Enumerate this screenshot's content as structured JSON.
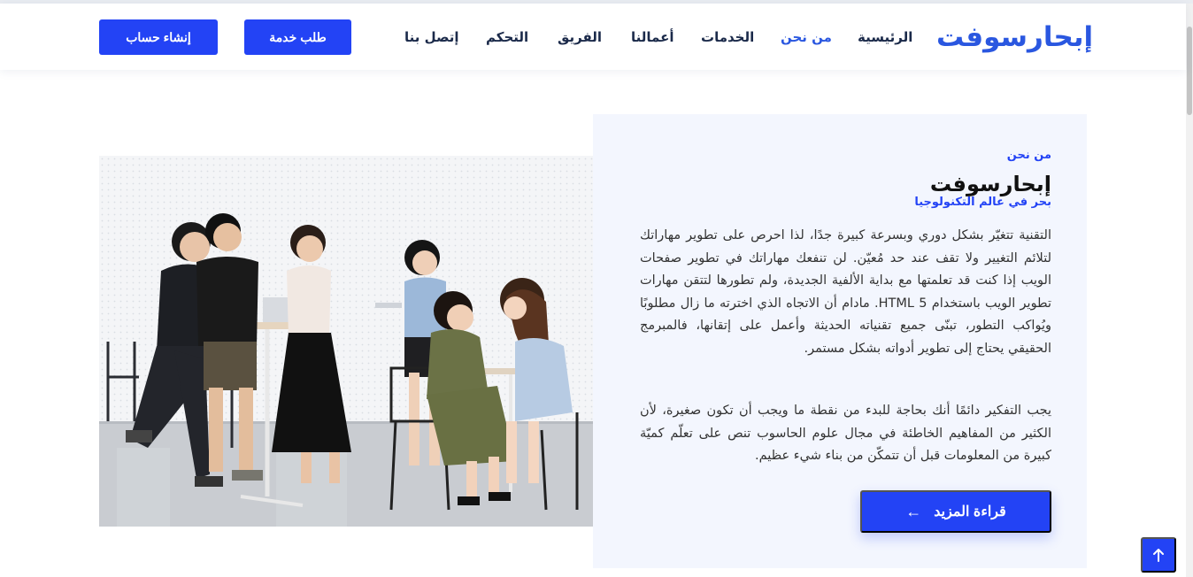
{
  "header": {
    "logo": "إبحارسوفت",
    "nav": [
      {
        "label": "الرئيسية"
      },
      {
        "label": "من نحن"
      },
      {
        "label": "الخدمات"
      },
      {
        "label": "أعمالنا"
      },
      {
        "label": "الفريق"
      },
      {
        "label": "التحكم"
      },
      {
        "label": "إتصل بنا"
      }
    ],
    "request_service": "طلب خدمة",
    "create_account": "إنشاء حساب"
  },
  "about": {
    "eyebrow": "من نحن",
    "title": "إبحارسوفت",
    "subtitle": "بحر في عالم التكنولوجيا",
    "paragraph1": "التقنية تتغيّر بشكل دوري وبسرعة كبيرة جدًا، لذا احرص على تطوير مهاراتك لتلائم التغيير ولا تقف عند حد مُعيّن. لن تنفعك مهاراتك في تطوير صفحات الويب إذا كنت قد تعلمتها مع بداية الألفية الجديدة، ولم تطورها لتتقن مهارات تطوير الويب باستخدام HTML 5. مادام أن الاتجاه الذي اخترته ما زال مطلوبًا ويُواكب التطور، تبنّى جميع تقنياته الحديثة وأعمل على إتقانها، فالمبرمج الحقيقي يحتاج إلى تطوير أدواته بشكل مستمر.",
    "paragraph2": "يجب التفكير دائمًا أنك بحاجة للبدء من نقطة ما ويجب أن تكون صغيرة، لأن الكثير من المفاهيم الخاطئة في مجال علوم الحاسوب تنص على تعلّم كميّة كبيرة من المعلومات قبل أن تتمكّن من بناء شيء عظيم.",
    "read_more": "قراءة المزيد",
    "read_more_icon": "arrow-left-icon"
  },
  "back_to_top_icon": "arrow-up-icon",
  "colors": {
    "primary": "#2343f5",
    "logo": "#2a57e0",
    "card_bg": "#f3f6fe",
    "nav_text": "#1b2a4a"
  }
}
